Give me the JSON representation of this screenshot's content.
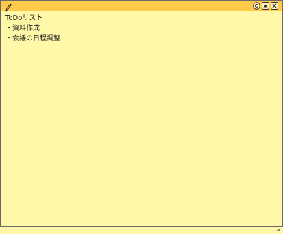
{
  "note": {
    "lines": [
      "ToDoリスト",
      "・資料作成",
      "・会議の日程調整"
    ]
  },
  "titlebar": {
    "color": "#ffc94a",
    "icons": [
      "pencil-icon",
      "settings-icon",
      "minimize-icon",
      "close-icon"
    ]
  },
  "colors": {
    "background": "#fff8a8",
    "titlebar": "#ffc94a"
  }
}
